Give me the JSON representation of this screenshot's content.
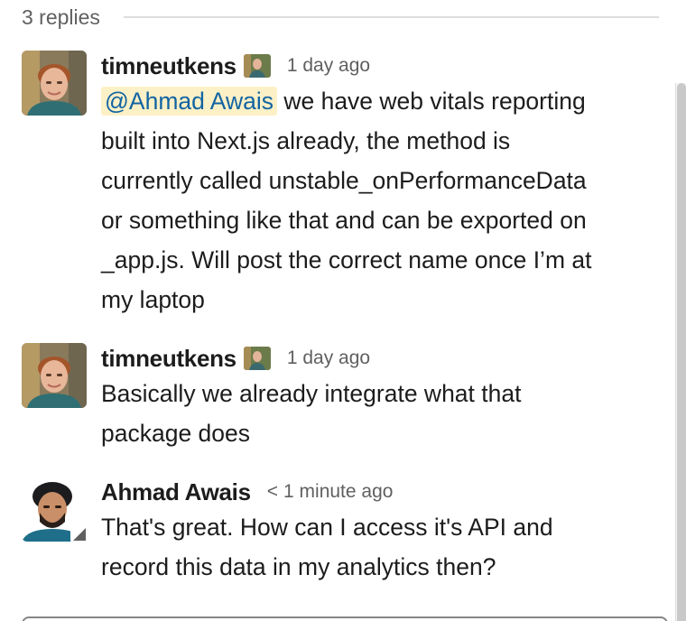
{
  "thread": {
    "replies_label": "3 replies"
  },
  "messages": [
    {
      "author": "timneutkens",
      "timestamp": "1 day ago",
      "mention": "@Ahmad Awais",
      "text_lines": [
        " we have web vitals reporting",
        "built into Next.js already, the method is",
        "currently called unstable_onPerformanceData",
        "or something like that and can be exported on",
        "_app.js. Will post the correct name once I’m at",
        "my laptop"
      ],
      "avatar_icon": "user-photo-avatar",
      "status_icon": "custom-status-photo-icon"
    },
    {
      "author": "timneutkens",
      "timestamp": "1 day ago",
      "text_lines": [
        "Basically we already integrate what that",
        "package does"
      ],
      "avatar_icon": "user-photo-avatar",
      "status_icon": "custom-status-photo-icon"
    },
    {
      "author": "Ahmad Awais",
      "timestamp_prefix": "<",
      "timestamp": "1 minute ago",
      "text_lines": [
        "That's great. How can I access it's API and",
        "record this data in my analytics then?"
      ],
      "avatar_icon": "user-photo-avatar",
      "presence_icon": "away-presence-icon"
    }
  ],
  "colors": {
    "mention_bg": "#fcf0c6",
    "mention_text": "#1264a3",
    "meta_text": "#616061",
    "body_text": "#1d1c1d"
  }
}
